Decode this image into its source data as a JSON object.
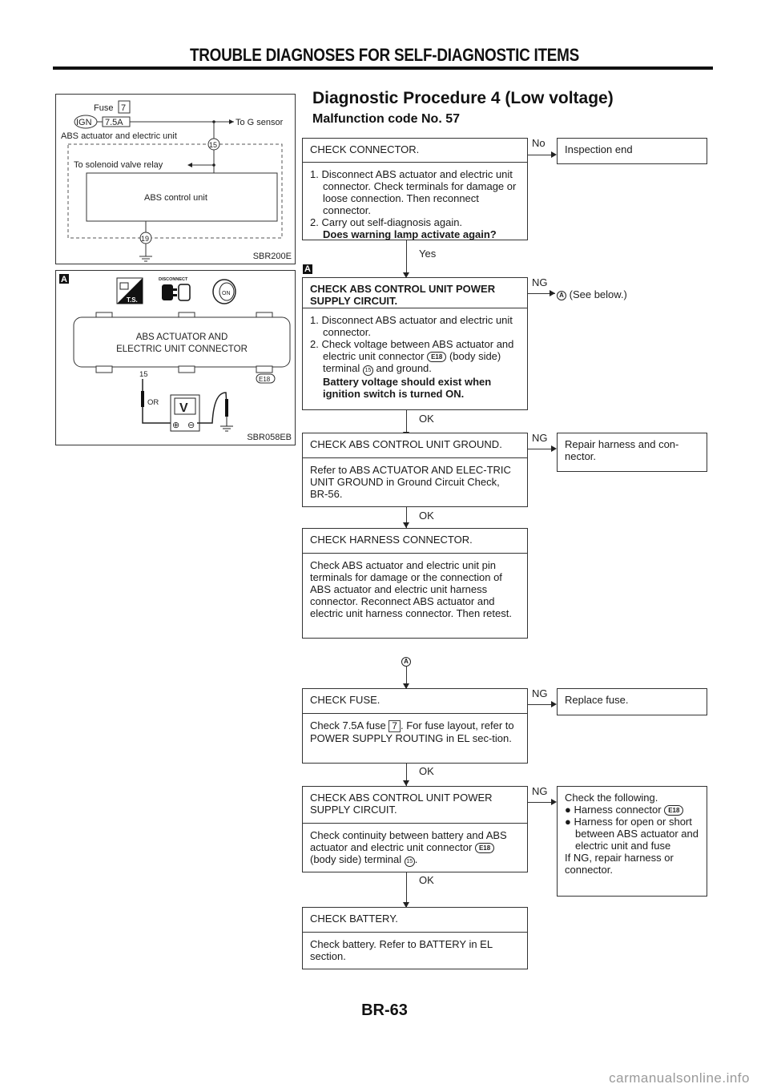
{
  "header": {
    "title": "TROUBLE DIAGNOSES FOR SELF-DIAGNOSTIC ITEMS"
  },
  "figure1": {
    "code": "SBR200E",
    "fuse_label": "Fuse",
    "fuse_number": "7",
    "ign_label": "IGN",
    "fuse_rating": "7.5A",
    "to_g_sensor": "To G sensor",
    "unit_label": "ABS actuator and electric unit",
    "terminal_top": "15",
    "to_solenoid": "To solenoid valve relay",
    "control_unit": "ABS control unit",
    "terminal_bottom": "19"
  },
  "figure2": {
    "code": "SBR058EB",
    "tag": "A",
    "icon_ts_label": "T.S.",
    "icon_disconnect_label": "DISCONNECT",
    "icon_key_label": "ON",
    "connector_line1": "ABS ACTUATOR AND",
    "connector_line2": "ELECTRIC UNIT CONNECTOR",
    "pin": "15",
    "wire_color": "OR",
    "connector_id": "E18",
    "meter_label": "V",
    "plus": "⊕",
    "minus": "⊖"
  },
  "procedure": {
    "title": "Diagnostic Procedure 4 (Low voltage)",
    "subtitle": "Malfunction code No. 57",
    "steps": [
      {
        "heading": "CHECK CONNECTOR.",
        "body": [
          "1. Disconnect ABS actuator and electric unit connector. Check terminals for damage or loose connection. Then reconnect connector.",
          "2. Carry out self-diagnosis again."
        ],
        "question": "Does warning lamp activate again?",
        "branch_label": "No",
        "branch_result": "Inspection end",
        "next_label": "Yes"
      },
      {
        "tag": "A",
        "heading": "CHECK ABS CONTROL UNIT POWER SUPPLY CIRCUIT.",
        "body_1": "1. Disconnect ABS actuator and electric unit connector.",
        "body_2a": "2. Check voltage between ABS actuator and electric unit connector",
        "connector": "E18",
        "body_2b": "(body side) terminal",
        "terminal": "15",
        "body_2c": "and ground.",
        "spec": "Battery voltage should exist when ignition switch is turned ON.",
        "branch_label": "NG",
        "branch_ref": "A",
        "branch_result": "(See below.)",
        "next_label": "OK"
      },
      {
        "heading": "CHECK ABS CONTROL UNIT GROUND.",
        "body": "Refer to ABS ACTUATOR AND ELEC-TRIC UNIT GROUND in Ground Circuit Check, BR-56.",
        "branch_label": "NG",
        "branch_result": "Repair harness and con-nector.",
        "next_label": "OK"
      },
      {
        "heading": "CHECK HARNESS CONNECTOR.",
        "body": "Check ABS actuator and electric unit pin terminals for damage or the connection of ABS actuator and electric unit harness connector. Reconnect ABS actuator and electric unit harness connector. Then retest."
      },
      {
        "entry_ref": "A",
        "heading": "CHECK FUSE.",
        "body_a": "Check 7.5A fuse",
        "fuse": "7",
        "body_b": ". For fuse layout, refer to POWER SUPPLY ROUTING in EL sec-tion.",
        "branch_label": "NG",
        "branch_result": "Replace fuse.",
        "next_label": "OK"
      },
      {
        "heading": "CHECK ABS CONTROL UNIT POWER SUPPLY CIRCUIT.",
        "body_a": "Check continuity between battery and ABS actuator and electric unit connector",
        "connector": "E18",
        "body_b": "(body side) terminal",
        "terminal": "15",
        "body_c": ".",
        "branch_label": "NG",
        "branch_intro": "Check the following.",
        "branch_bullet1": "Harness connector",
        "branch_connector": "E18",
        "branch_bullet2": "Harness for open or short between ABS actuator and electric unit and fuse",
        "branch_outro": "If NG, repair harness or connector.",
        "next_label": "OK"
      },
      {
        "heading": "CHECK BATTERY.",
        "body": "Check battery. Refer to BATTERY in EL section."
      }
    ]
  },
  "footer": {
    "page": "BR-63",
    "watermark": "carmanualsonline.info"
  }
}
